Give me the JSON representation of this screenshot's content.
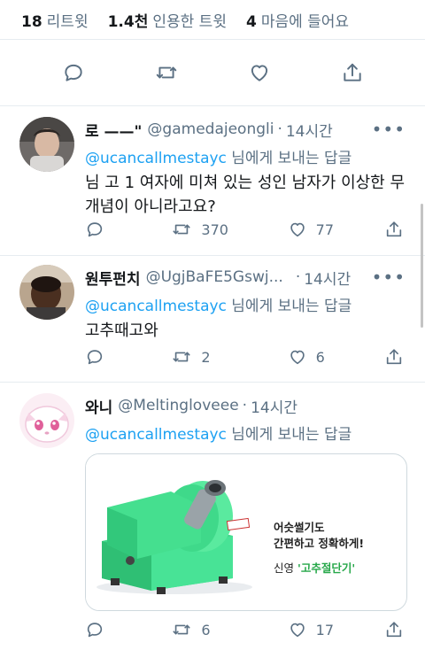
{
  "stats": {
    "retweets_count": "18",
    "retweets_label": "리트윗",
    "quotes_count": "1.4천",
    "quotes_label": "인용한 트윗",
    "likes_count": "4",
    "likes_label": "마음에 들어요"
  },
  "main_actions": [
    "reply-icon",
    "retweet-icon",
    "like-icon",
    "share-icon"
  ],
  "tweets": [
    {
      "name": "로 ——\"",
      "handle": "@gamedajeongli",
      "dot": "·",
      "time": "14시간",
      "more": "•••",
      "reply_mention": "@ucancallmestayc",
      "reply_suffix": " 님에게 보내는 답글",
      "text": "님 고 1 여자에 미쳐 있는 성인 남자가 이상한 무 개념이 아니라고요?",
      "retweets": "370",
      "likes": "77"
    },
    {
      "name": "원투펀치",
      "handle": "@UgjBaFE5Gswj...",
      "dot": "·",
      "time": "14시간",
      "more": "•••",
      "reply_mention": "@ucancallmestayc",
      "reply_suffix": " 님에게 보내는 답글",
      "text": "고추때고와",
      "retweets": "2",
      "likes": "6"
    },
    {
      "name": "와니",
      "handle": "@Meltingloveee",
      "dot": "·",
      "time": "14시간",
      "more": "",
      "reply_mention": "@ucancallmestayc",
      "reply_suffix": " 님에게 보내는 답글",
      "card": {
        "caption_line1": "어슷썰기도",
        "caption_line2": "간편하고 정확하게!",
        "brand_prefix": "신영",
        "brand_name": "'고추절단기'"
      },
      "retweets": "6",
      "likes": "17"
    }
  ],
  "colors": {
    "link": "#1da1f2",
    "secondary": "#5b7083",
    "divider": "#e6ecf0",
    "machine_green": "#3fd98a"
  }
}
